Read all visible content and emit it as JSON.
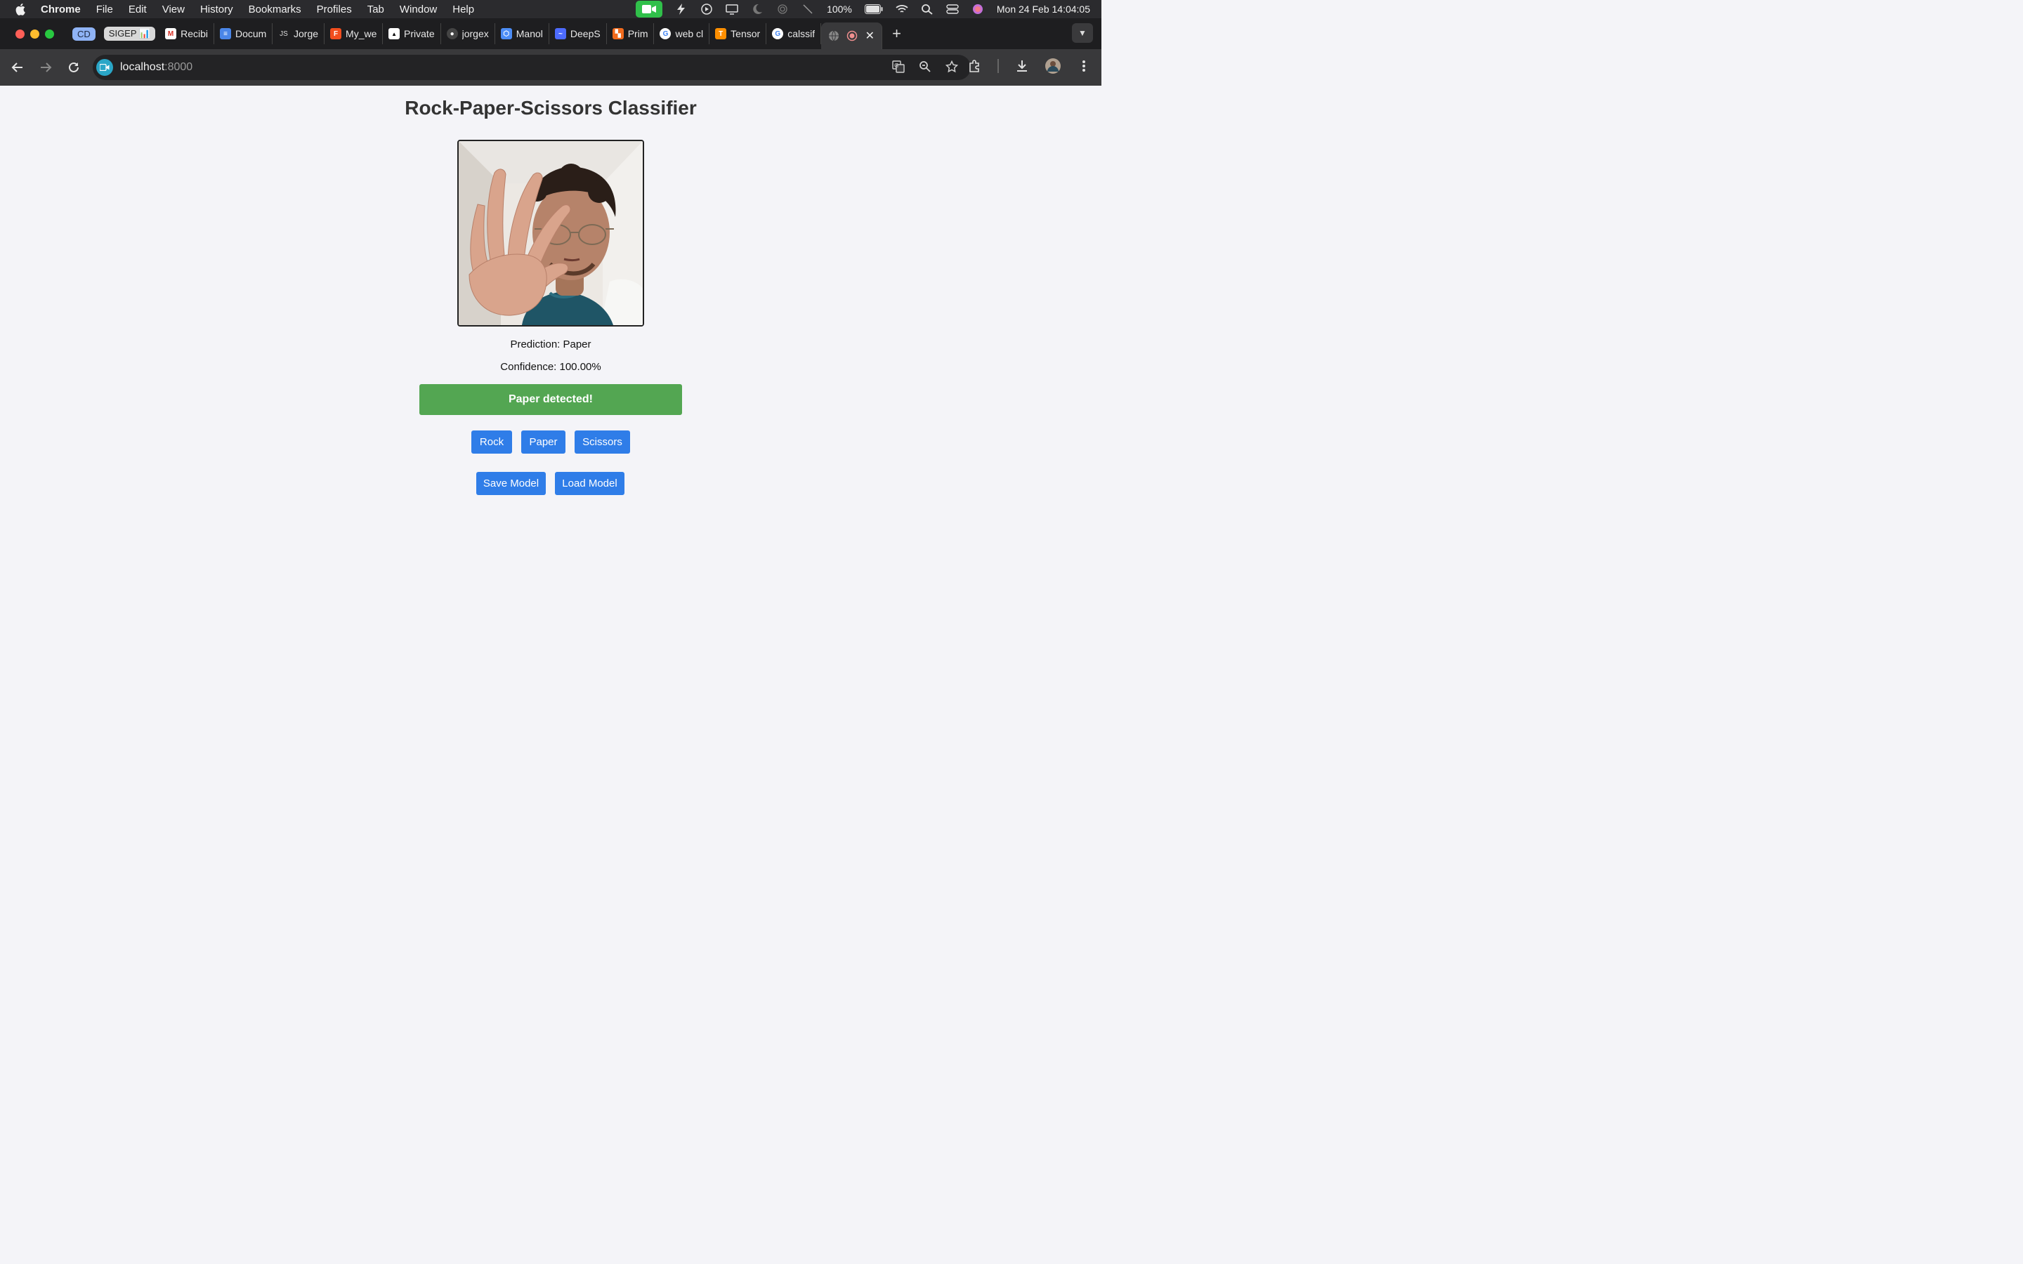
{
  "menubar": {
    "app_name": "Chrome",
    "menus": [
      "File",
      "Edit",
      "View",
      "History",
      "Bookmarks",
      "Profiles",
      "Tab",
      "Window",
      "Help"
    ],
    "battery": "100%",
    "datetime": "Mon 24 Feb  14:04:05"
  },
  "tabs": {
    "groups": [
      {
        "label": "CD",
        "color": "#8fb3f5"
      },
      {
        "label": "SIGEP 📊",
        "color": "#d8d8d8"
      }
    ],
    "items": [
      {
        "title": "Recibi",
        "icon": "gmail-icon",
        "color": "#d93025"
      },
      {
        "title": "Docum",
        "icon": "docs-icon",
        "color": "#4a86e8"
      },
      {
        "title": "Jorge",
        "icon": "js-icon",
        "color": "#1e1e20"
      },
      {
        "title": "My_we",
        "icon": "figma-icon",
        "color": "#f24e1e"
      },
      {
        "title": "Private",
        "icon": "vercel-icon",
        "color": "#ffffff"
      },
      {
        "title": "jorgex",
        "icon": "github-icon",
        "color": "#444444"
      },
      {
        "title": "Manol",
        "icon": "hexagon-icon",
        "color": "#4c8df6"
      },
      {
        "title": "DeepS",
        "icon": "deepseek-icon",
        "color": "#4d6bfe"
      },
      {
        "title": "Prim",
        "icon": "prim-icon",
        "color": "#f26b1d"
      },
      {
        "title": "web cl",
        "icon": "google-icon",
        "color": "#ffffff"
      },
      {
        "title": "Tensor",
        "icon": "tensorflow-icon",
        "color": "#ff8f00"
      },
      {
        "title": "calssif",
        "icon": "google-icon",
        "color": "#ffffff"
      }
    ]
  },
  "toolbar": {
    "url_host": "localhost",
    "url_port": ":8000"
  },
  "page": {
    "title": "Rock-Paper-Scissors Classifier",
    "prediction": "Prediction: Paper",
    "confidence": "Confidence: 100.00%",
    "result_banner": "Paper detected!",
    "class_buttons": {
      "rock": "Rock",
      "paper": "Paper",
      "scissors": "Scissors"
    },
    "model_buttons": {
      "save": "Save Model",
      "load": "Load Model"
    }
  },
  "colors": {
    "accent_button": "#2f7de8",
    "success_banner": "#53a652",
    "page_background": "#f4f4f8"
  }
}
